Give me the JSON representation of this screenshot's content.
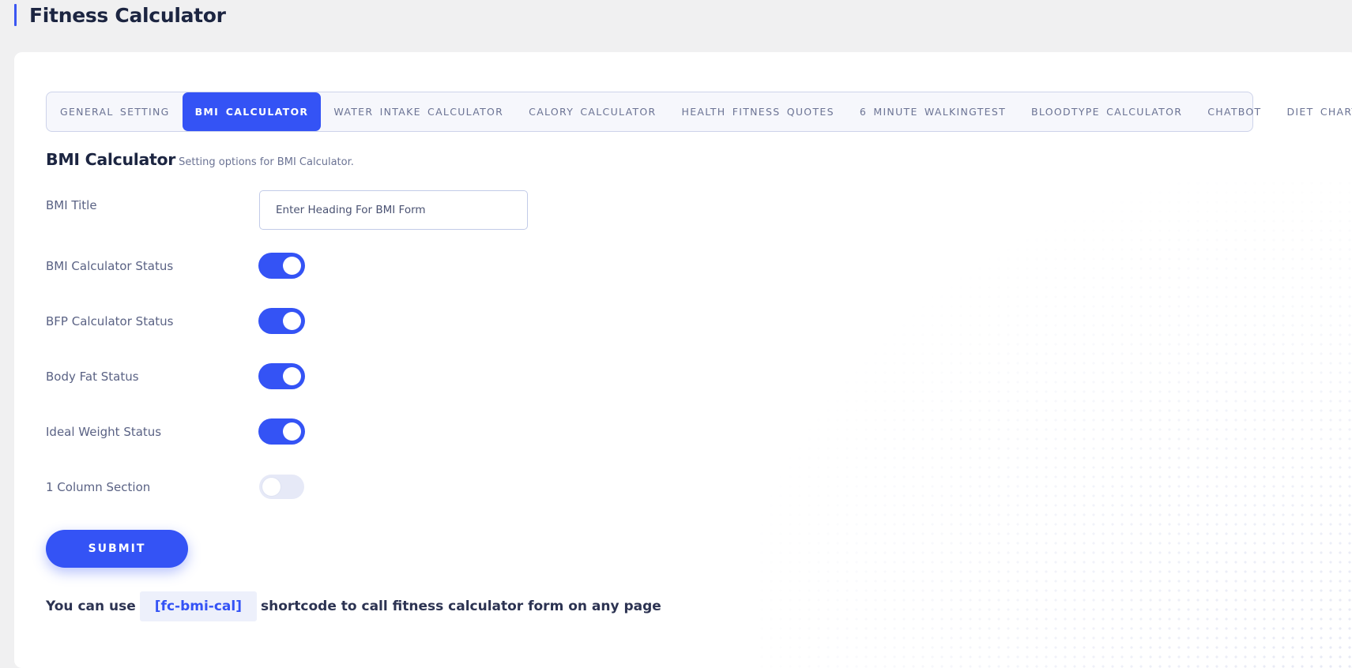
{
  "page": {
    "title": "Fitness Calculator"
  },
  "tabs": [
    {
      "label": "GENERAL SETTING",
      "active": false
    },
    {
      "label": "BMI CALCULATOR",
      "active": true
    },
    {
      "label": "WATER INTAKE CALCULATOR",
      "active": false
    },
    {
      "label": "CALORY CALCULATOR",
      "active": false
    },
    {
      "label": "HEALTH FITNESS QUOTES",
      "active": false
    },
    {
      "label": "6 MINUTE WALKINGTEST",
      "active": false
    },
    {
      "label": "BLOODTYPE CALCULATOR",
      "active": false
    },
    {
      "label": "CHATBOT",
      "active": false
    },
    {
      "label": "DIET CHART",
      "active": false
    }
  ],
  "section": {
    "title": "BMI Calculator",
    "subtitle": "Setting options for BMI Calculator."
  },
  "fields": {
    "bmi_title": {
      "label": "BMI Title",
      "value": "",
      "placeholder": "Enter Heading For BMI Form"
    },
    "toggles": [
      {
        "label": "BMI Calculator Status",
        "on": true
      },
      {
        "label": "BFP Calculator Status",
        "on": true
      },
      {
        "label": "Body Fat Status",
        "on": true
      },
      {
        "label": "Ideal Weight Status",
        "on": true
      },
      {
        "label": "1 Column Section",
        "on": false
      }
    ]
  },
  "submit_label": "SUBMIT",
  "shortcode_info": {
    "prefix": "You can use",
    "code": "[fc-bmi-cal]",
    "suffix": "shortcode to call fitness calculator form on any page"
  },
  "colors": {
    "accent": "#3453f5",
    "heading": "#1c2541",
    "muted": "#6b7394",
    "background": "#f0f0f1"
  }
}
